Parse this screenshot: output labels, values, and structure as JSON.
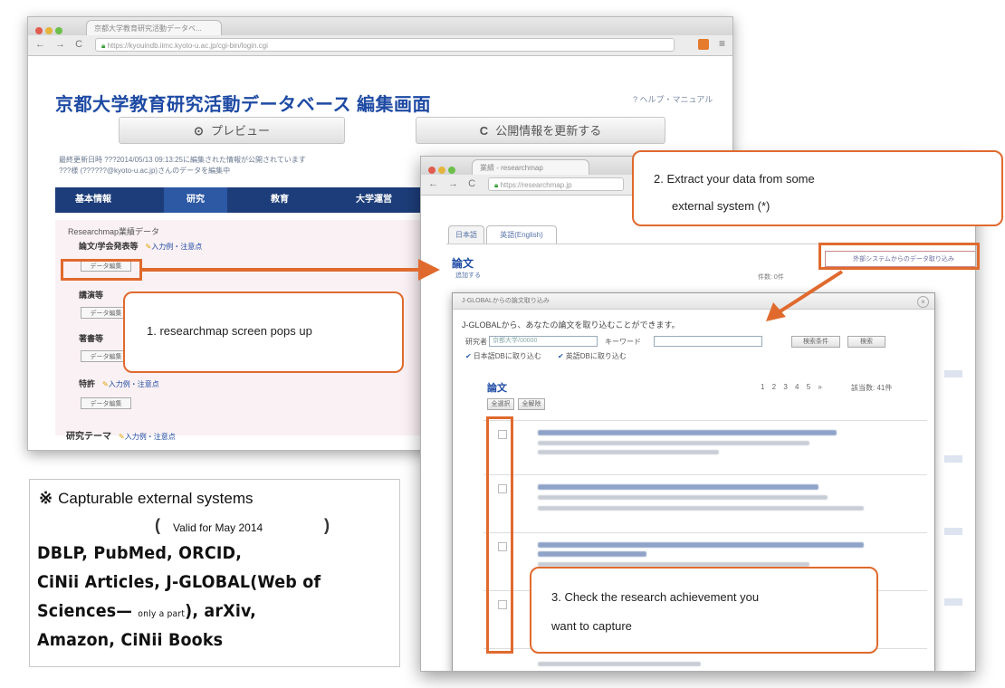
{
  "browser1": {
    "tab_title": "京都大学教育研究活動データベ...",
    "url": "https://kyouindb.iimc.kyoto-u.ac.jp/cgi-bin/login.cgi",
    "title": "京都大学教育研究活動データベース 編集画面",
    "help_link": "? ヘルプ・マニュアル",
    "preview_button": "プレビュー",
    "update_button": "公開情報を更新する",
    "info_line1": "最終更新日時 ???2014/05/13 09:13:25に編集された情報が公開されています",
    "info_line2": "???様 (??????@kyoto-u.ac.jp)さんのデータを編集中",
    "nav": [
      "基本情報",
      "研究",
      "教育",
      "大学運営"
    ],
    "researchmap_label": "Researchmap業績データ",
    "sections": [
      {
        "label": "論文/学会発表等",
        "edit": "入力例・注意点",
        "button": "データ編集"
      },
      {
        "label": "講演等",
        "edit": "",
        "button": "データ編集"
      },
      {
        "label": "著書等",
        "edit": "",
        "button": "データ編集"
      },
      {
        "label": "特許",
        "edit": "入力例・注意点",
        "button": "データ編集"
      }
    ],
    "theme_label": "研究テーマ",
    "theme_edit": "入力例・注意点"
  },
  "browser2": {
    "tab_title": "業績 - researchmap",
    "url": "https://researchmap.jp",
    "lang_tabs": [
      "日本語",
      "英語(English)"
    ],
    "section_title": "論文",
    "ext_button": "外部システムからのデータ取り込み",
    "add_link": "追加する",
    "count_label": "件数: 0件",
    "dialog": {
      "header": "J-GLOBALからの論文取り込み",
      "description": "J-GLOBALから、あなたの論文を取り込むことができます。",
      "researcher_label": "研究者",
      "researcher_value": "京都大学/00000",
      "keyword_label": "キーワード",
      "search_button": "検索",
      "select_button": "検索条件",
      "check_ja": "日本語DBに取り込む",
      "check_en": "英語DBに取り込む",
      "paper_title": "論文",
      "select_all": "全選択",
      "deselect_all": "全解除",
      "pages": "1 2 3 4 5 »",
      "result_count": "該当数: 41件"
    }
  },
  "callouts": {
    "c1": "1. researchmap screen pops up",
    "c2_line1": "2. Extract your data from some",
    "c2_line2": "external system (*)",
    "c3_line1": "3. Check the research achievement you",
    "c3_line2": "want to capture"
  },
  "note": {
    "mark": "※",
    "title": "Capturable external systems",
    "paren_open": "(",
    "valid": "Valid for May 2014",
    "paren_close": ")",
    "line1": "DBLP, PubMed, ORCID,",
    "line2": "CiNii Articles, J-GLOBAL(Web of",
    "line3_a": "Sciences—",
    "line3_small": "only a part",
    "line3_b": "), arXiv,",
    "line4": "Amazon, CiNii Books"
  },
  "colors": {
    "accent_orange": "#e06a2e",
    "title_blue": "#1e4aa3",
    "nav_navy": "#1d3d7a",
    "pink_panel": "#faf1f4"
  }
}
